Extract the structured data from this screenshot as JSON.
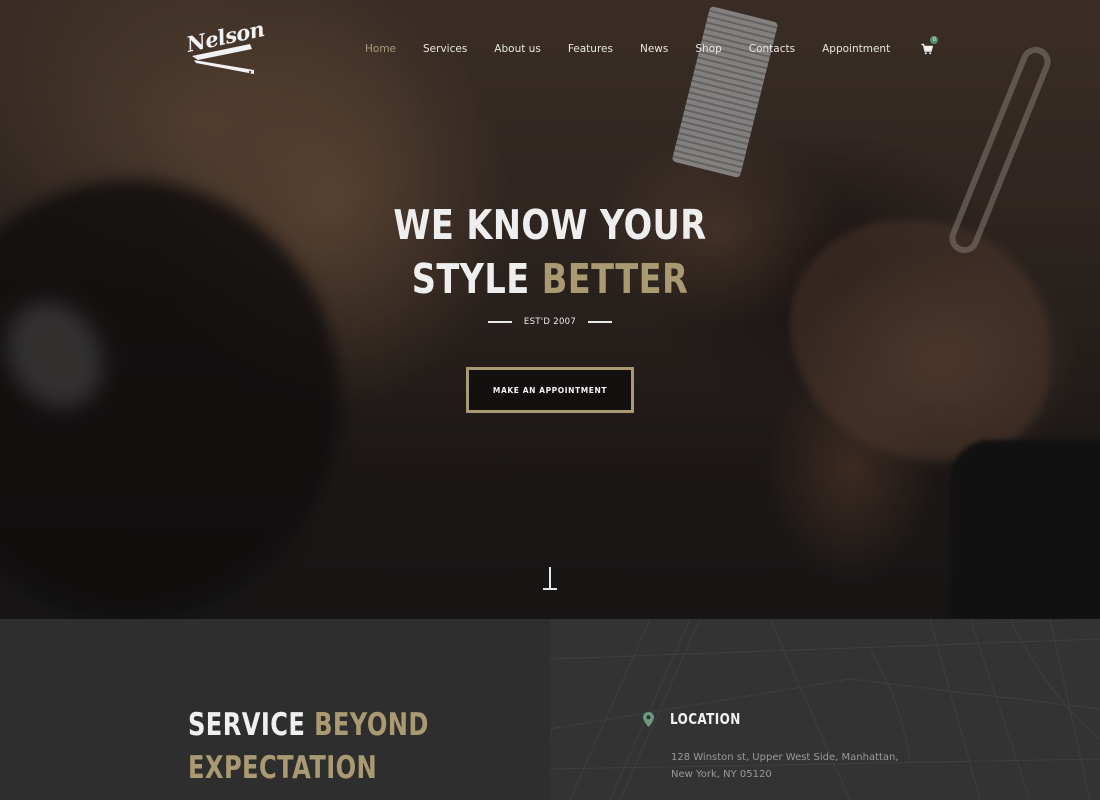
{
  "brand": {
    "logo_text": "Nelson"
  },
  "nav": {
    "items": [
      {
        "label": "Home",
        "active": true
      },
      {
        "label": "Services",
        "active": false
      },
      {
        "label": "About us",
        "active": false
      },
      {
        "label": "Features",
        "active": false
      },
      {
        "label": "News",
        "active": false
      },
      {
        "label": "Shop",
        "active": false
      },
      {
        "label": "Contacts",
        "active": false
      },
      {
        "label": "Appointment",
        "active": false
      }
    ],
    "cart_icon": "shopping-cart-icon",
    "cart_count": "0"
  },
  "hero": {
    "title_line1": "WE KNOW YOUR",
    "title_line2_plain": "STYLE",
    "title_line2_accent": "BETTER",
    "established": "EST'D 2007",
    "cta_label": "MAKE AN APPOINTMENT",
    "scroll_icon": "scroll-down-icon"
  },
  "service": {
    "title_plain": "SERVICE",
    "title_accent_1": "BEYOND",
    "title_accent_2": "EXPECTATION"
  },
  "location": {
    "icon": "map-pin-icon",
    "label": "LOCATION",
    "address_line1": "128 Winston st, Upper West Side, Manhattan,",
    "address_line2": "New York, NY 05120"
  },
  "colors": {
    "accent_gold": "#a99a72",
    "nav_active": "#a89a80",
    "pin_green": "#6a9a80",
    "cart_badge": "#5d8e73",
    "dark_panel": "#2e2e2e",
    "map_panel": "#333333"
  }
}
